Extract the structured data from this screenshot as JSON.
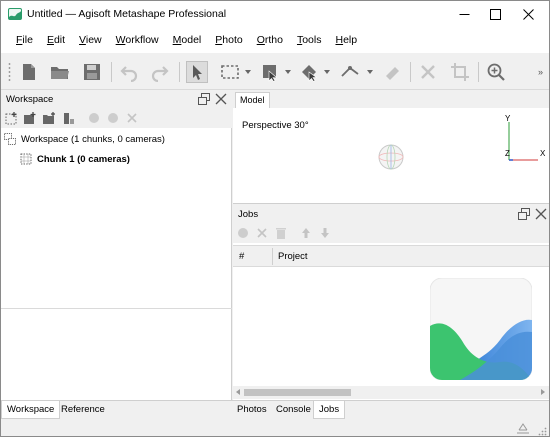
{
  "window": {
    "title": "Untitled — Agisoft Metashape Professional",
    "icons": {
      "app": "metashape-logo-icon",
      "minimize": "minimize-icon",
      "maximize": "maximize-icon",
      "close": "close-icon"
    }
  },
  "menu": {
    "items": [
      {
        "label": "File",
        "accel": "F",
        "rest": "ile"
      },
      {
        "label": "Edit",
        "accel": "E",
        "rest": "dit"
      },
      {
        "label": "View",
        "accel": "V",
        "rest": "iew"
      },
      {
        "label": "Workflow",
        "accel": "W",
        "rest": "orkflow"
      },
      {
        "label": "Model",
        "accel": "M",
        "rest": "odel"
      },
      {
        "label": "Photo",
        "accel": "P",
        "rest": "hoto"
      },
      {
        "label": "Ortho",
        "accel": "O",
        "rest": "rtho"
      },
      {
        "label": "Tools",
        "accel": "T",
        "rest": "ools"
      },
      {
        "label": "Help",
        "accel": "H",
        "rest": "elp"
      }
    ]
  },
  "toolbar": {
    "buttons": [
      "new-document-icon",
      "open-folder-icon",
      "save-icon",
      "undo-icon",
      "redo-icon",
      "navigation-arrow-icon",
      "rectangle-selection-icon",
      "model-selection-icon",
      "shape-selection-icon",
      "draw-polyline-icon",
      "eraser-icon",
      "delete-icon",
      "crop-icon",
      "zoom-icon"
    ],
    "overflow": "»"
  },
  "workspace": {
    "title": "Workspace",
    "tree": {
      "root_label": "Workspace (1 chunks, 0 cameras)",
      "chunk_label": "Chunk 1 (0 cameras)"
    }
  },
  "model": {
    "tab_label": "Model",
    "projection_label": "Perspective 30°",
    "axes": {
      "y": "Y",
      "z": "Z",
      "x": "X"
    }
  },
  "jobs": {
    "title": "Jobs",
    "columns": [
      "#",
      "Project"
    ]
  },
  "bottom_tabs": {
    "left": [
      "Workspace",
      "Reference"
    ],
    "right": [
      "Photos",
      "Console",
      "Jobs"
    ],
    "active_left": "Workspace",
    "active_right": "Jobs"
  },
  "colors": {
    "logo_green": "#3cc46f",
    "logo_blue": "#4a8fd9",
    "axis_y": "#2e9c3a",
    "axis_z": "#2f55c9",
    "axis_x": "#d23a3a"
  }
}
